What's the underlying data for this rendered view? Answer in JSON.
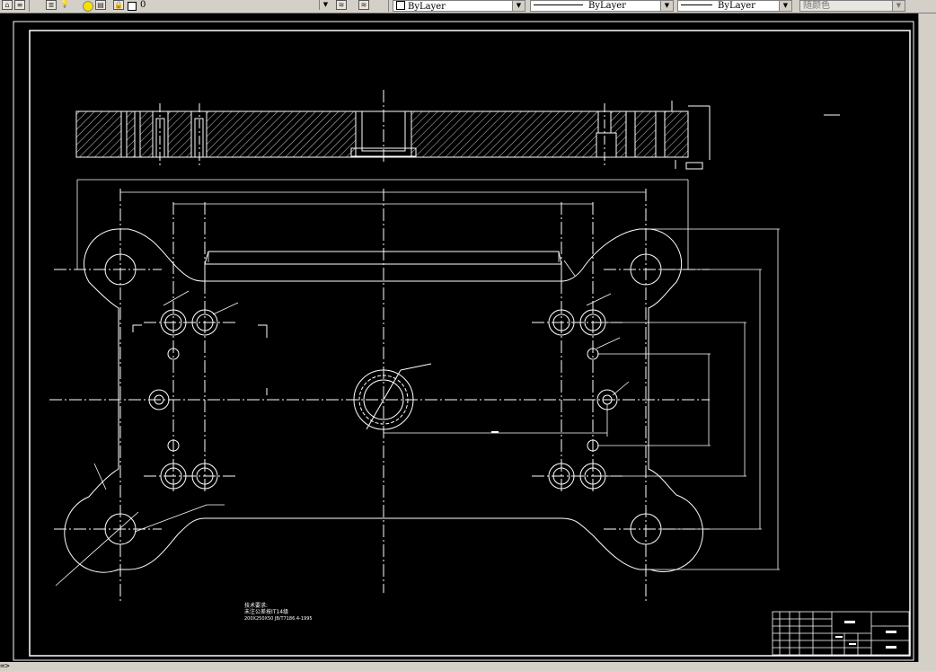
{
  "toolbar": {
    "layer_name": "0",
    "color_value": "ByLayer",
    "linetype_value": "ByLayer",
    "lineweight_value": "ByLayer",
    "plotstyle_value": "随颜色"
  },
  "icons": [
    "home-icon",
    "layer-manager-icon",
    "bulb-on-icon",
    "sun-icon",
    "layer-state-icon",
    "lock-icon",
    "layer-color-icon",
    "make-current-icon",
    "layer-previous-icon",
    "color-swatch-icon",
    "dropdown-arrow-icon"
  ],
  "colors": {
    "canvas": "#000000",
    "lines": "#ffffff",
    "ui_face": "#d4d0c8"
  },
  "drawing": {
    "tech_req_title": "技术要求:",
    "tech_req_line1": "未注公差按IT14级",
    "tech_req_line2": "200X250X50    JB/T7186.4-1995"
  },
  "command_line": "=>"
}
